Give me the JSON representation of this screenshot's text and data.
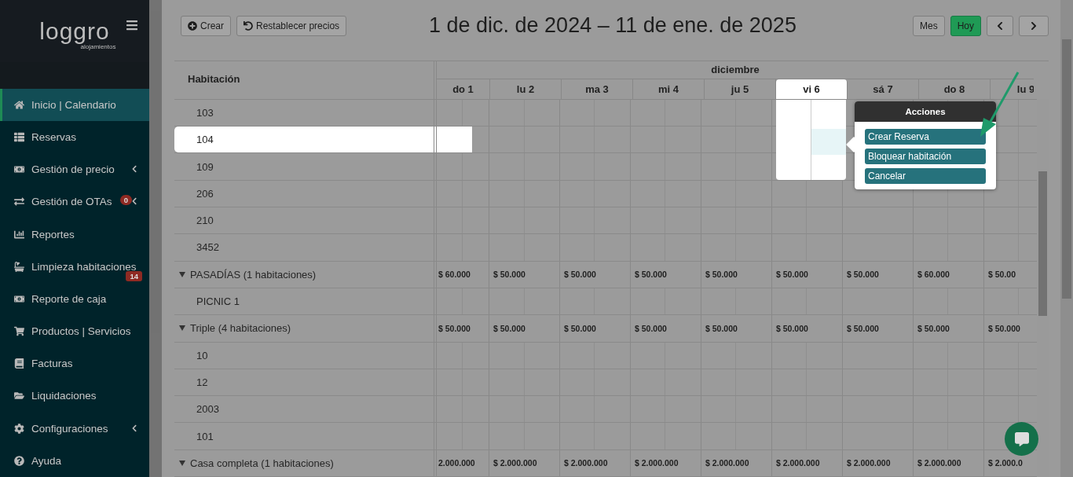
{
  "sidebar": {
    "logo": {
      "name": "loggro",
      "tagline": "alojamientos"
    },
    "items": [
      {
        "label": "Inicio | Calendario",
        "selected": true,
        "submenu": false
      },
      {
        "label": "Reservas",
        "selected": false,
        "submenu": false
      },
      {
        "label": "Gestión de precio",
        "selected": false,
        "submenu": true
      },
      {
        "label": "Gestión de OTAs",
        "selected": false,
        "submenu": true,
        "badge": "0"
      },
      {
        "label": "Reportes",
        "selected": false,
        "submenu": false
      },
      {
        "label": "Limpieza habitaciones",
        "selected": false,
        "submenu": false,
        "badge": "14"
      },
      {
        "label": "Reporte de caja",
        "selected": false,
        "submenu": false
      },
      {
        "label": "Productos | Servicios",
        "selected": false,
        "submenu": false
      },
      {
        "label": "Facturas",
        "selected": false,
        "submenu": false
      },
      {
        "label": "Liquidaciones",
        "selected": false,
        "submenu": false
      },
      {
        "label": "Configuraciones",
        "selected": false,
        "submenu": true
      },
      {
        "label": "Ayuda",
        "selected": false,
        "submenu": false
      }
    ]
  },
  "toolbar": {
    "create": "Crear",
    "reset": "Restablecer precios",
    "title": "1 de dic. de 2024 – 11 de ene. de 2025",
    "view": "Mes",
    "today": "Hoy"
  },
  "calendar": {
    "resource_heading": "Habitación",
    "month": "diciembre",
    "days": [
      {
        "label": "do 1",
        "highlighted": false
      },
      {
        "label": "lu 2",
        "highlighted": false
      },
      {
        "label": "ma 3",
        "highlighted": false
      },
      {
        "label": "mi 4",
        "highlighted": false
      },
      {
        "label": "ju 5",
        "highlighted": false
      },
      {
        "label": "vi 6",
        "highlighted": true
      },
      {
        "label": "sá 7",
        "highlighted": false
      },
      {
        "label": "do 8",
        "highlighted": false
      },
      {
        "label": "lu 9",
        "highlighted": false
      }
    ],
    "rows": [
      {
        "kind": "room",
        "name": "103",
        "highlighted": false
      },
      {
        "kind": "room",
        "name": "104",
        "highlighted": true
      },
      {
        "kind": "room",
        "name": "109",
        "highlighted": false
      },
      {
        "kind": "room",
        "name": "206",
        "highlighted": false
      },
      {
        "kind": "room",
        "name": "210",
        "highlighted": false
      },
      {
        "kind": "room",
        "name": "3452",
        "highlighted": false
      },
      {
        "kind": "group",
        "name": "PASADÍAS (1 habitaciones)",
        "expanded": true,
        "prices": [
          "$ 60.000",
          "$ 50.000",
          "$ 50.000",
          "$ 50.000",
          "$ 50.000",
          "$ 50.000",
          "$ 50.000",
          "$ 60.000",
          "$ 50.00"
        ]
      },
      {
        "kind": "room",
        "name": "PICNIC 1",
        "highlighted": false
      },
      {
        "kind": "group",
        "name": "Triple (4 habitaciones)",
        "expanded": true,
        "prices": [
          "$ 50.000",
          "$ 50.000",
          "$ 50.000",
          "$ 50.000",
          "$ 50.000",
          "$ 50.000",
          "$ 50.000",
          "$ 50.000",
          "$ 50.000"
        ]
      },
      {
        "kind": "room",
        "name": "10",
        "highlighted": false
      },
      {
        "kind": "room",
        "name": "12",
        "highlighted": false
      },
      {
        "kind": "room",
        "name": "2003",
        "highlighted": false
      },
      {
        "kind": "room",
        "name": "101",
        "highlighted": false
      },
      {
        "kind": "group",
        "name": "Casa completa (1 habitaciones)",
        "expanded": true,
        "prices": [
          "2.000.000",
          "$ 2.000.000",
          "$ 2.000.000",
          "$ 2.000.000",
          "$ 2.000.000",
          "$ 2.000.000",
          "$ 2.000.000",
          "$ 2.000.000",
          "$ 2.000.0"
        ]
      }
    ]
  },
  "actions_popup": {
    "title": "Acciones",
    "buttons": [
      "Crear Reserva",
      "Bloquear habitación",
      "Cancelar"
    ]
  }
}
